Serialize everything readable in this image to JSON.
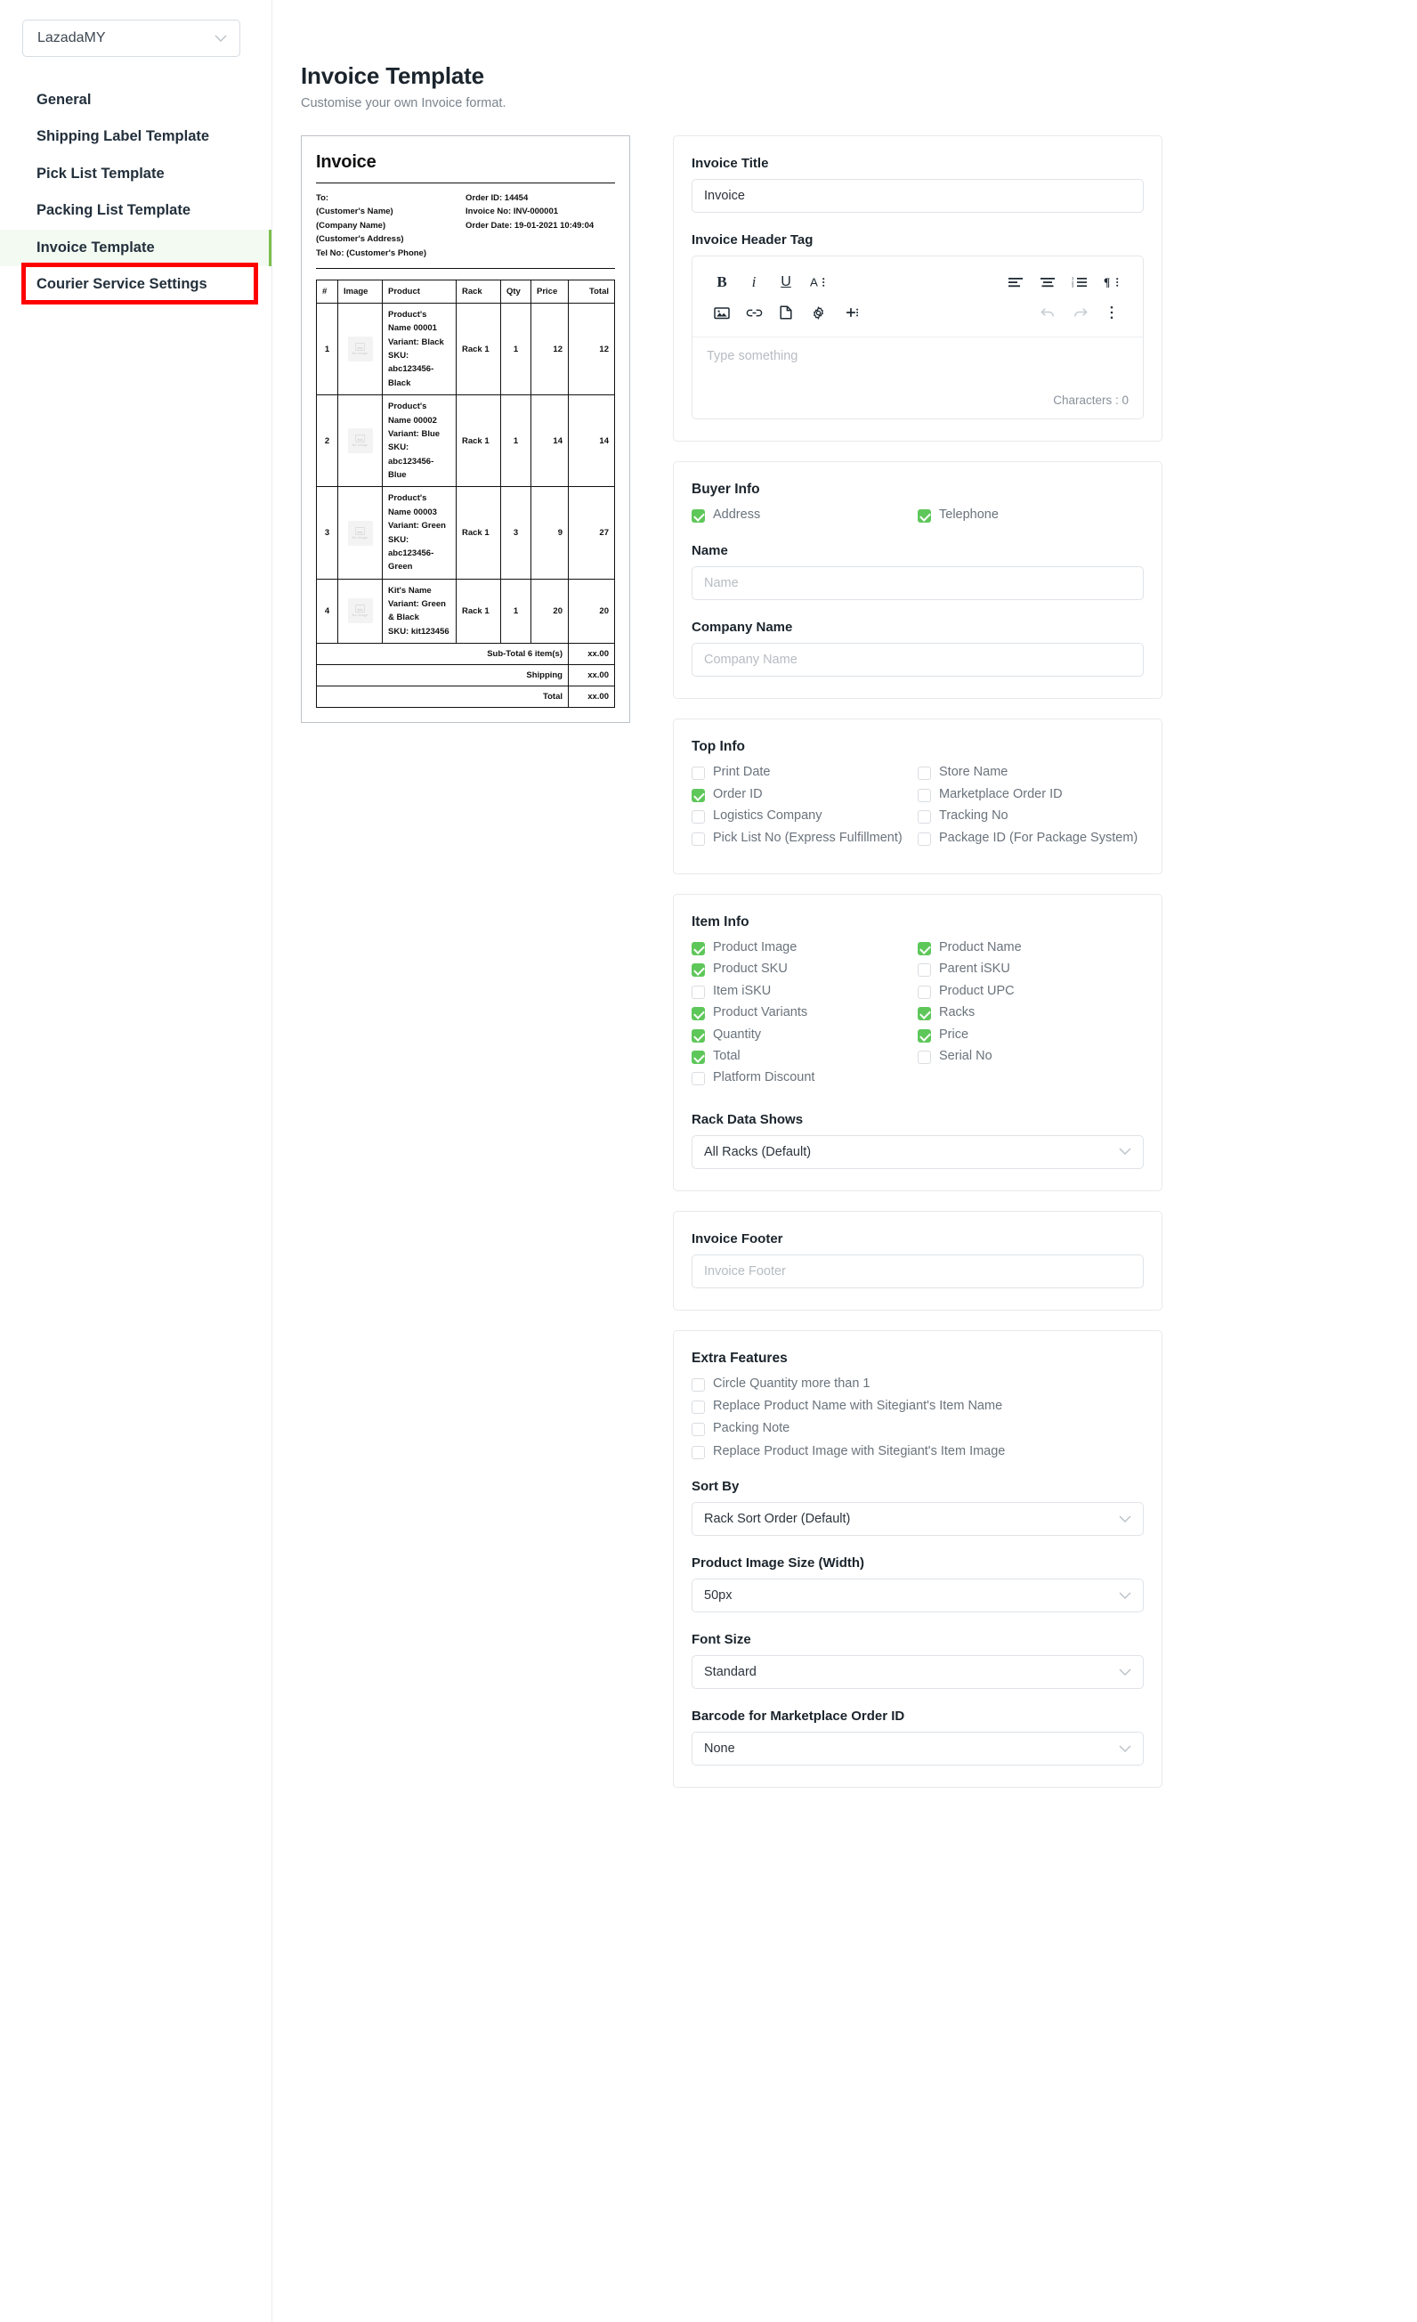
{
  "store_selector": {
    "value": "LazadaMY",
    "icon": "chevron-down-icon"
  },
  "sidebar": {
    "items": [
      {
        "label": "General",
        "active": false
      },
      {
        "label": "Shipping Label Template",
        "active": false
      },
      {
        "label": "Pick List Template",
        "active": false
      },
      {
        "label": "Packing List Template",
        "active": false
      },
      {
        "label": "Invoice Template",
        "active": true
      },
      {
        "label": "Courier Service Settings",
        "active": false
      }
    ]
  },
  "header": {
    "title": "Invoice Template",
    "subtitle": "Customise your own Invoice format."
  },
  "preview": {
    "title": "Invoice",
    "to_block": [
      "To:",
      "(Customer's Name)",
      "(Company Name)",
      "(Customer's Address)",
      "Tel No: (Customer's Phone)"
    ],
    "meta_block": [
      "Order ID: 14454",
      "Invoice No: INV-000001",
      "Order Date: 19-01-2021 10:49:04"
    ],
    "table": {
      "columns": [
        "#",
        "Image",
        "Product",
        "Rack",
        "Qty",
        "Price",
        "Total"
      ],
      "image_placeholder": "No image",
      "rows": [
        {
          "num": "1",
          "name": "Product's Name 00001",
          "variant": "Variant: Black",
          "sku": "SKU: abc123456-Black",
          "rack": "Rack 1",
          "qty": "1",
          "price": "12",
          "total": "12"
        },
        {
          "num": "2",
          "name": "Product's Name 00002",
          "variant": "Variant: Blue",
          "sku": "SKU: abc123456-Blue",
          "rack": "Rack 1",
          "qty": "1",
          "price": "14",
          "total": "14"
        },
        {
          "num": "3",
          "name": "Product's Name 00003",
          "variant": "Variant: Green",
          "sku": "SKU: abc123456-Green",
          "rack": "Rack 1",
          "qty": "3",
          "price": "9",
          "total": "27"
        },
        {
          "num": "4",
          "name": "Kit's Name",
          "variant": "Variant: Green & Black",
          "sku": "SKU: kit123456",
          "rack": "Rack 1",
          "qty": "1",
          "price": "20",
          "total": "20"
        }
      ],
      "summary": [
        {
          "label": "Sub-Total 6 item(s)",
          "value": "xx.00"
        },
        {
          "label": "Shipping",
          "value": "xx.00"
        },
        {
          "label": "Total",
          "value": "xx.00"
        }
      ]
    }
  },
  "invoice_title": {
    "label": "Invoice Title",
    "value": "Invoice"
  },
  "header_tag": {
    "label": "Invoice Header Tag",
    "placeholder": "Type something",
    "char_count": "Characters : 0",
    "toolbar_row1": [
      "bold-icon",
      "italic-icon",
      "underline-icon",
      "font-style-icon",
      "align-left-icon",
      "align-center-icon",
      "ordered-list-icon",
      "paragraph-icon"
    ],
    "toolbar_row2": [
      "image-icon",
      "link-icon",
      "file-icon",
      "gear-icon",
      "insert-icon",
      "undo-icon",
      "redo-icon",
      "more-icon"
    ]
  },
  "buyer_info": {
    "title": "Buyer Info",
    "checkboxes": [
      {
        "label": "Address",
        "checked": true
      },
      {
        "label": "Telephone",
        "checked": true
      }
    ],
    "name_label": "Name",
    "name_placeholder": "Name",
    "company_label": "Company Name",
    "company_placeholder": "Company Name"
  },
  "top_info": {
    "title": "Top Info",
    "left": [
      {
        "label": "Print Date",
        "checked": false
      },
      {
        "label": "Order ID",
        "checked": true
      },
      {
        "label": "Logistics Company",
        "checked": false
      },
      {
        "label": "Pick List No (Express Fulfillment)",
        "checked": false
      }
    ],
    "right": [
      {
        "label": "Store Name",
        "checked": false
      },
      {
        "label": "Marketplace Order ID",
        "checked": false
      },
      {
        "label": "Tracking No",
        "checked": false
      },
      {
        "label": "Package ID (For Package System)",
        "checked": false
      }
    ]
  },
  "item_info": {
    "title": "Item Info",
    "left": [
      {
        "label": "Product Image",
        "checked": true
      },
      {
        "label": "Product SKU",
        "checked": true
      },
      {
        "label": "Item iSKU",
        "checked": false
      },
      {
        "label": "Product Variants",
        "checked": true
      },
      {
        "label": "Quantity",
        "checked": true
      },
      {
        "label": "Total",
        "checked": true
      },
      {
        "label": "Platform Discount",
        "checked": false
      }
    ],
    "right": [
      {
        "label": "Product Name",
        "checked": true
      },
      {
        "label": "Parent iSKU",
        "checked": false
      },
      {
        "label": "Product UPC",
        "checked": false
      },
      {
        "label": "Racks",
        "checked": true
      },
      {
        "label": "Price",
        "checked": true
      },
      {
        "label": "Serial No",
        "checked": false
      }
    ],
    "rack_data_label": "Rack Data Shows",
    "rack_data_value": "All Racks (Default)"
  },
  "invoice_footer": {
    "label": "Invoice Footer",
    "placeholder": "Invoice Footer"
  },
  "extra_features": {
    "title": "Extra Features",
    "checkboxes": [
      {
        "label": "Circle Quantity more than 1",
        "checked": false
      },
      {
        "label": "Replace Product Name with Sitegiant's Item Name",
        "checked": false
      },
      {
        "label": "Packing Note",
        "checked": false
      },
      {
        "label": "Replace Product Image with Sitegiant's Item Image",
        "checked": false
      }
    ],
    "sort_by_label": "Sort By",
    "sort_by_value": "Rack Sort Order (Default)",
    "image_size_label": "Product Image Size (Width)",
    "image_size_value": "50px",
    "font_size_label": "Font Size",
    "font_size_value": "Standard",
    "barcode_label": "Barcode for Marketplace Order ID",
    "barcode_value": "None"
  },
  "colors": {
    "accent_green": "#5ec75a",
    "nav_active_bg": "#f3faf2",
    "nav_active_bar": "#7cbf4f",
    "annotation_red": "#fe0000"
  }
}
